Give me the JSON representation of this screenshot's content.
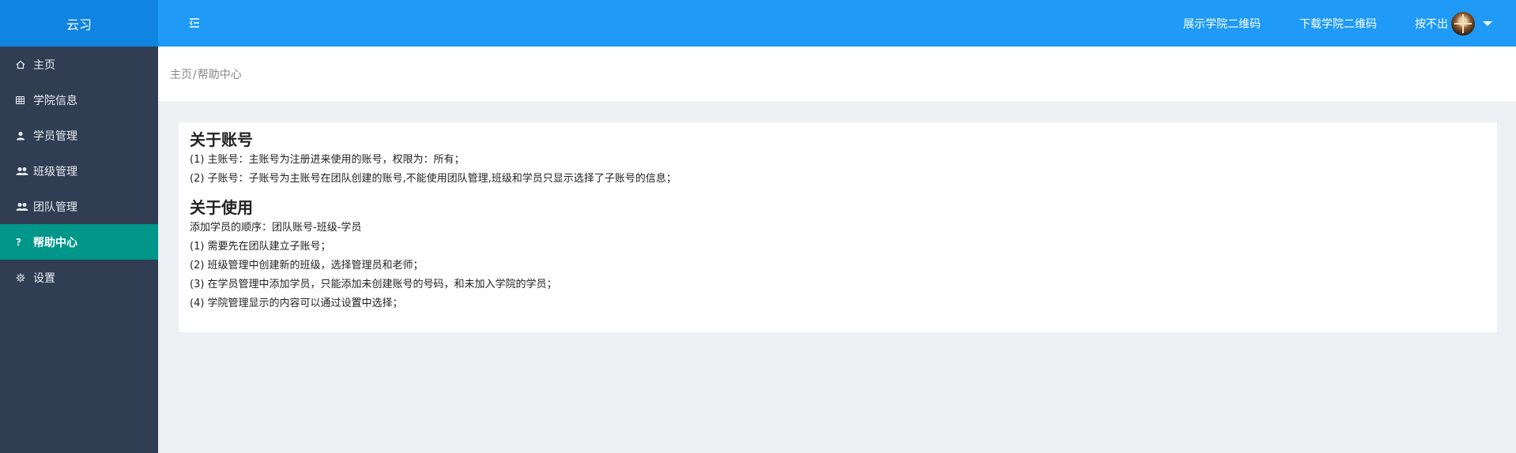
{
  "app": {
    "name": "云习"
  },
  "sidebar": {
    "items": [
      {
        "label": "主页",
        "icon": "home-icon"
      },
      {
        "label": "学院信息",
        "icon": "grid-icon"
      },
      {
        "label": "学员管理",
        "icon": "user-icon"
      },
      {
        "label": "班级管理",
        "icon": "users-icon"
      },
      {
        "label": "团队管理",
        "icon": "users-icon"
      },
      {
        "label": "帮助中心",
        "icon": "question-icon",
        "active": true
      },
      {
        "label": "设置",
        "icon": "gear-icon"
      }
    ]
  },
  "topbar": {
    "show_qr": "展示学院二维码",
    "download_qr": "下载学院二维码",
    "username": "按不出"
  },
  "breadcrumb": {
    "home": "主页",
    "sep": "/",
    "current": "帮助中心"
  },
  "content": {
    "account": {
      "title": "关于账号",
      "lines": [
        "(1) 主账号：主账号为注册进来使用的账号，权限为：所有；",
        "(2) 子账号：子账号为主账号在团队创建的账号,不能使用团队管理,班级和学员只显示选择了子账号的信息；"
      ]
    },
    "usage": {
      "title": "关于使用",
      "lines": [
        "添加学员的顺序：团队账号-班级-学员",
        "(1) 需要先在团队建立子账号；",
        "(2) 班级管理中创建新的班级，选择管理员和老师；",
        "(3) 在学员管理中添加学员，只能添加未创建账号的号码，和未加入学院的学员；",
        "(4) 学院管理显示的内容可以通过设置中选择；"
      ]
    }
  },
  "colors": {
    "sidebar_bg": "#303d52",
    "logo_bg": "#0f84e0",
    "topbar_bg": "#1f9bf7",
    "active_item": "#00968a",
    "page_bg": "#eef0f4"
  }
}
